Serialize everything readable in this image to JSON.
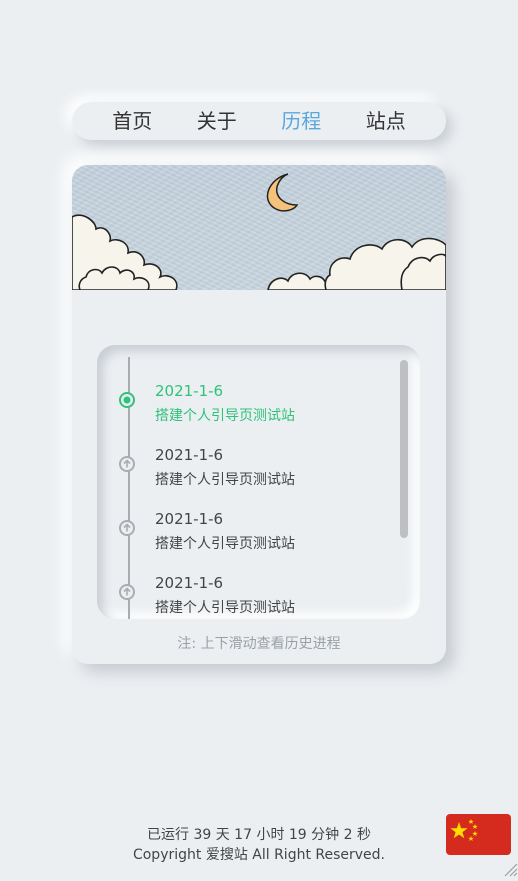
{
  "nav": {
    "items": [
      {
        "label": "首页",
        "active": false
      },
      {
        "label": "关于",
        "active": false
      },
      {
        "label": "历程",
        "active": true
      },
      {
        "label": "站点",
        "active": false
      }
    ],
    "active_color": "#5aa7dc"
  },
  "timeline": {
    "entries": [
      {
        "date": "2021-1-6",
        "text": "搭建个人引导页测试站",
        "active": true
      },
      {
        "date": "2021-1-6",
        "text": "搭建个人引导页测试站",
        "active": false
      },
      {
        "date": "2021-1-6",
        "text": "搭建个人引导页测试站",
        "active": false
      },
      {
        "date": "2021-1-6",
        "text": "搭建个人引导页测试站",
        "active": false
      }
    ],
    "active_color": "#2ec27a",
    "note": "注: 上下滑动查看历史进程"
  },
  "footer": {
    "runtime": "已运行 39 天 17 小时 19 分钟 2 秒",
    "copyright": "Copyright 爱搜站 All Right Reserved."
  },
  "flag": {
    "icon": "china-flag-icon",
    "color": "#d52b1e"
  }
}
